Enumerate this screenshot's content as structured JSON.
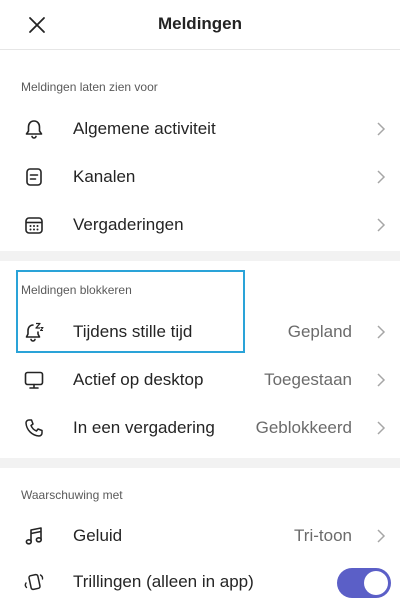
{
  "header": {
    "title": "Meldingen",
    "close_icon": "close-icon"
  },
  "sections": [
    {
      "label": "Meldingen laten zien voor",
      "items": [
        {
          "label": "Algemene activiteit",
          "icon": "bell-icon"
        },
        {
          "label": "Kanalen",
          "icon": "channel-icon"
        },
        {
          "label": "Vergaderingen",
          "icon": "calendar-icon"
        }
      ]
    },
    {
      "label": "Meldingen blokkeren",
      "items": [
        {
          "label": "Tijdens stille tijd",
          "value": "Gepland",
          "icon": "quiet-time-bell-icon"
        },
        {
          "label": "Actief op desktop",
          "value": "Toegestaan",
          "icon": "desktop-icon"
        },
        {
          "label": "In een vergadering",
          "value": "Geblokkeerd",
          "icon": "phone-icon"
        }
      ]
    },
    {
      "label": "Waarschuwing met",
      "items": [
        {
          "label": "Geluid",
          "value": "Tri-toon",
          "icon": "music-note-icon"
        },
        {
          "label": "Trillingen (alleen in app)",
          "icon": "vibrate-icon",
          "toggle_on": true
        }
      ]
    }
  ],
  "colors": {
    "accent": "#5b5fc7",
    "highlight_border": "#2aa3d8",
    "separator": "#f2f2f2"
  }
}
